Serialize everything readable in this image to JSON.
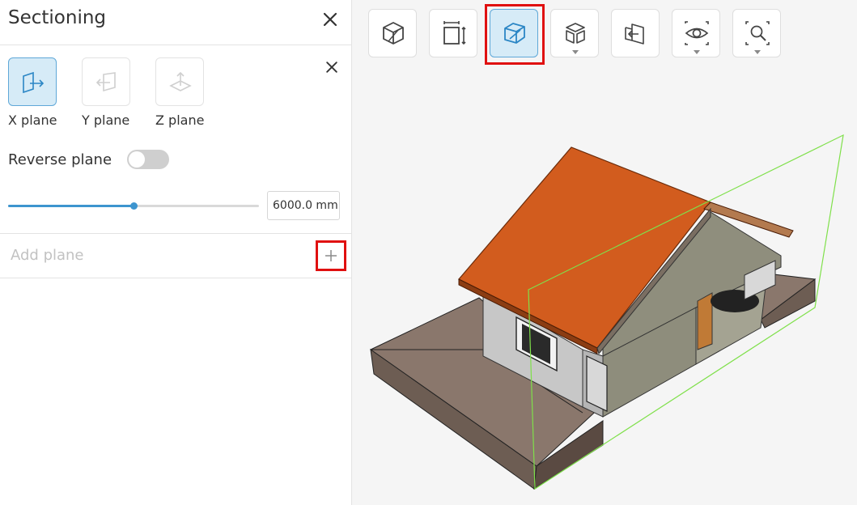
{
  "panel": {
    "title": "Sectioning",
    "planes": [
      {
        "label": "X plane",
        "active": true
      },
      {
        "label": "Y plane",
        "active": false
      },
      {
        "label": "Z plane",
        "active": false
      }
    ],
    "reverse_label": "Reverse plane",
    "reverse_on": false,
    "slider_fraction": 0.5,
    "value": "6000.0 mm",
    "add_plane_placeholder": "Add plane"
  },
  "toolbar": {
    "tools": [
      {
        "name": "home-view",
        "icon": "cube-outline-icon",
        "dropdown": false,
        "active": false
      },
      {
        "name": "measure",
        "icon": "measure-icon",
        "dropdown": false,
        "active": false
      },
      {
        "name": "section",
        "icon": "section-cube-icon",
        "dropdown": false,
        "active": true
      },
      {
        "name": "explode",
        "icon": "explode-cube-icon",
        "dropdown": true,
        "active": false
      },
      {
        "name": "plane-cut",
        "icon": "plane-cut-icon",
        "dropdown": false,
        "active": false
      },
      {
        "name": "visibility",
        "icon": "eye-icon",
        "dropdown": true,
        "active": false
      },
      {
        "name": "zoom",
        "icon": "zoom-icon",
        "dropdown": true,
        "active": false
      }
    ]
  },
  "colors": {
    "accent": "#3d95cf",
    "active_bg": "#d6ebf7",
    "highlight": "#e01010",
    "roof": "#d25c1e",
    "section_plane": "#7fe04a"
  }
}
